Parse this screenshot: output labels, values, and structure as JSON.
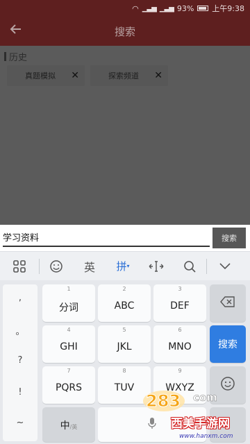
{
  "status_bar": {
    "battery_percent": "93%",
    "time": "上午9:38"
  },
  "app_bar": {
    "title": "搜索"
  },
  "history": {
    "heading": "历史",
    "chips": [
      {
        "label": "真题模拟"
      },
      {
        "label": "探索频道"
      }
    ]
  },
  "search": {
    "value": "学习资料",
    "button_label": "搜索"
  },
  "toolbar": {
    "english_label": "英",
    "pinyin_label": "拼"
  },
  "punctuation": [
    ",",
    "。",
    "?",
    "!",
    "~"
  ],
  "keys": {
    "row1": [
      {
        "num": "1",
        "label": "分词"
      },
      {
        "num": "2",
        "label": "ABC"
      },
      {
        "num": "3",
        "label": "DEF"
      }
    ],
    "row2": [
      {
        "num": "4",
        "label": "GHI"
      },
      {
        "num": "5",
        "label": "JKL"
      },
      {
        "num": "6",
        "label": "MNO"
      }
    ],
    "row3": [
      {
        "num": "7",
        "label": "PQRS"
      },
      {
        "num": "8",
        "label": "TUV"
      },
      {
        "num": "9",
        "label": "WXYZ"
      }
    ],
    "search_label": "搜索",
    "switch_label": "中",
    "switch_sub": "/英"
  },
  "watermark": {
    "brand": "西美手游网",
    "brand_logo_text": "283",
    "brand_logo_suffix": "com",
    "url": "www.hanxm.com"
  }
}
